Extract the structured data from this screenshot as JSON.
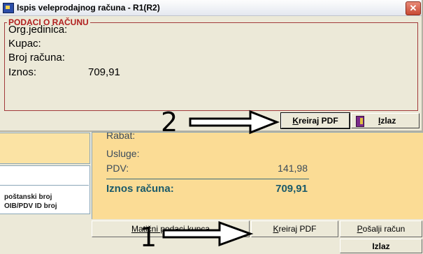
{
  "dialog": {
    "title": "Ispis veleprodajnog računa - R1(R2)",
    "close_glyph": "✕",
    "group_title": "PODACI O RAČUNU",
    "fields": {
      "org_label": "Org.jedinica:",
      "kupac_label": "Kupac:",
      "broj_label": "Broj računa:",
      "iznos_label": "Iznos:",
      "iznos_value": "709,91"
    },
    "buttons": {
      "kreiraj_pdf": "Kreiraj PDF",
      "kreiraj_pdf_accel": "K",
      "kreiraj_pdf_rest": "reiraj PDF",
      "izlaz_accel": "I",
      "izlaz_rest": "zlaz"
    }
  },
  "main": {
    "left_panel": {
      "postanski": "poštanski broj",
      "oib": "OIB/PDV ID broj"
    },
    "summary": {
      "rabat_label": "Rabat:",
      "usluge_label": "Usluge:",
      "pdv_label": "PDV:",
      "pdv_value": "141,98",
      "total_label": "Iznos računa:",
      "total_value": "709,91"
    },
    "buttons": {
      "maticni": "Matični podaci kupca",
      "kreiraj_accel": "K",
      "kreiraj_rest": "reiraj PDF",
      "posalji_accel": "P",
      "posalji_rest": "ošalji račun",
      "izlaz": "Izlaz"
    }
  },
  "annotations": {
    "step_2": "2",
    "step_1": "1"
  },
  "colors": {
    "group_border": "#a23a3a",
    "group_title": "#b01e1e",
    "summary_bg": "#fbdc95",
    "total_text": "#1a5a6a"
  },
  "icons": [
    "app-icon",
    "close-icon",
    "exit-door-icon"
  ]
}
